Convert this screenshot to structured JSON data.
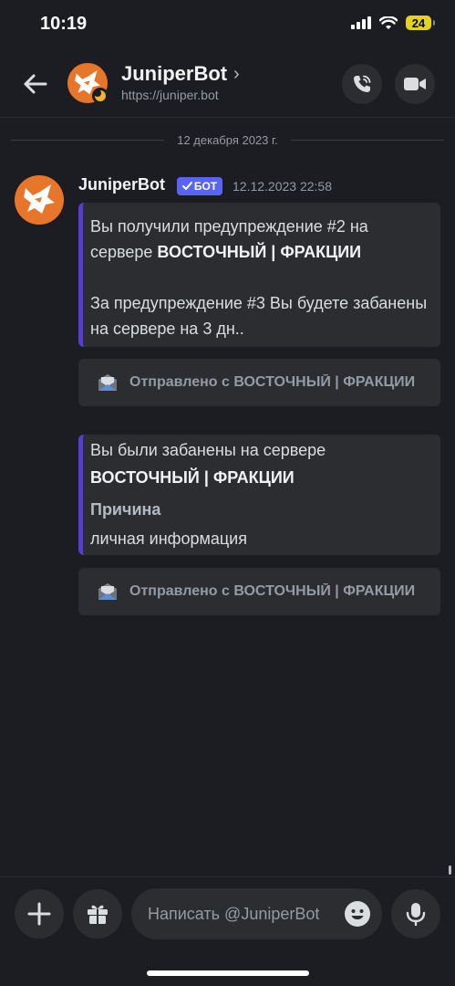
{
  "status_bar": {
    "time": "10:19",
    "battery": "24"
  },
  "header": {
    "name": "JuniperBot",
    "chevron": "›",
    "url": "https://juniper.bot",
    "icons": {
      "back": "arrow-left-icon",
      "call": "phone-call-icon",
      "video": "video-camera-icon"
    }
  },
  "chat": {
    "date_separator": "12 декабря 2023 г.",
    "message": {
      "author": "JuniperBot",
      "bot_tag": "БОТ",
      "timestamp": "12.12.2023 22:58"
    },
    "embed1": {
      "line1_prefix": "Вы получили предупреждение #2 на сервере ",
      "server": "ВОСТОЧНЫЙ | ФРАКЦИИ",
      "line2": "За предупреждение #3 Вы будете забанены на сервере на 3 дн.."
    },
    "source1": "Отправлено с ВОСТОЧНЫЙ | ФРАКЦИИ",
    "embed2": {
      "title_prefix": "Вы были забанены на сервере ",
      "server": "ВОСТОЧНЫЙ | ФРАКЦИИ",
      "field_name": "Причина",
      "field_value": "личная информация"
    },
    "source2": "Отправлено с ВОСТОЧНЫЙ | ФРАКЦИИ"
  },
  "composer": {
    "placeholder": "Написать @JuniperBot",
    "icons": {
      "plus": "plus-icon",
      "gift": "gift-icon",
      "emoji": "emoji-icon",
      "mic": "microphone-icon"
    }
  },
  "colors": {
    "background": "#1c1d22",
    "embed_bg": "#2b2d31",
    "embed_accent": "#5b3bd6",
    "bot_tag": "#5865f2",
    "avatar_orange": "#e8762a"
  }
}
